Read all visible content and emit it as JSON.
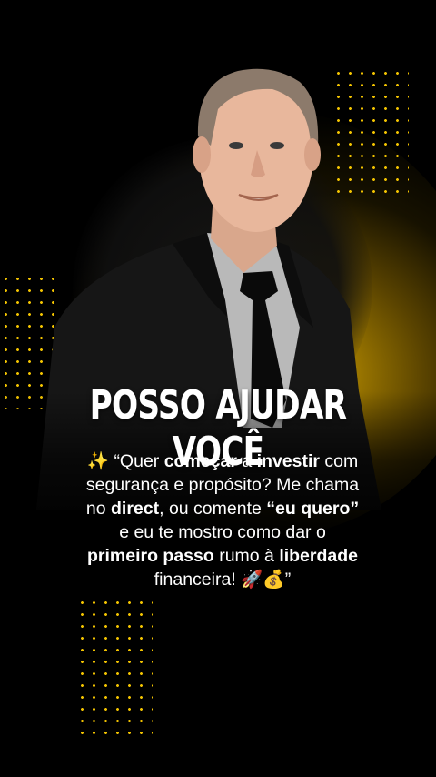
{
  "headline": "POSSO AJUDAR VOCÊ",
  "caption": {
    "line1": {
      "emoji": "✨",
      "q_open": "“Quer ",
      "b1": "começar",
      "t1": " a ",
      "b2": "investir",
      "t2": " com"
    },
    "line2": "segurança e propósito? Me chama",
    "line3": {
      "t1": "no ",
      "b1": "direct",
      "t2": ", ou comente ",
      "b2": "“eu quero”"
    },
    "line4": "e eu te mostro como dar o",
    "line5": {
      "b1": "primeiro passo",
      "t1": " rumo à ",
      "b2": "liberdade"
    },
    "line6": {
      "t1": "financeira! ",
      "emoji": "🚀💰",
      "q_close": "”"
    }
  },
  "colors": {
    "accent": "#f2c300",
    "background": "#000000",
    "text": "#ffffff"
  }
}
